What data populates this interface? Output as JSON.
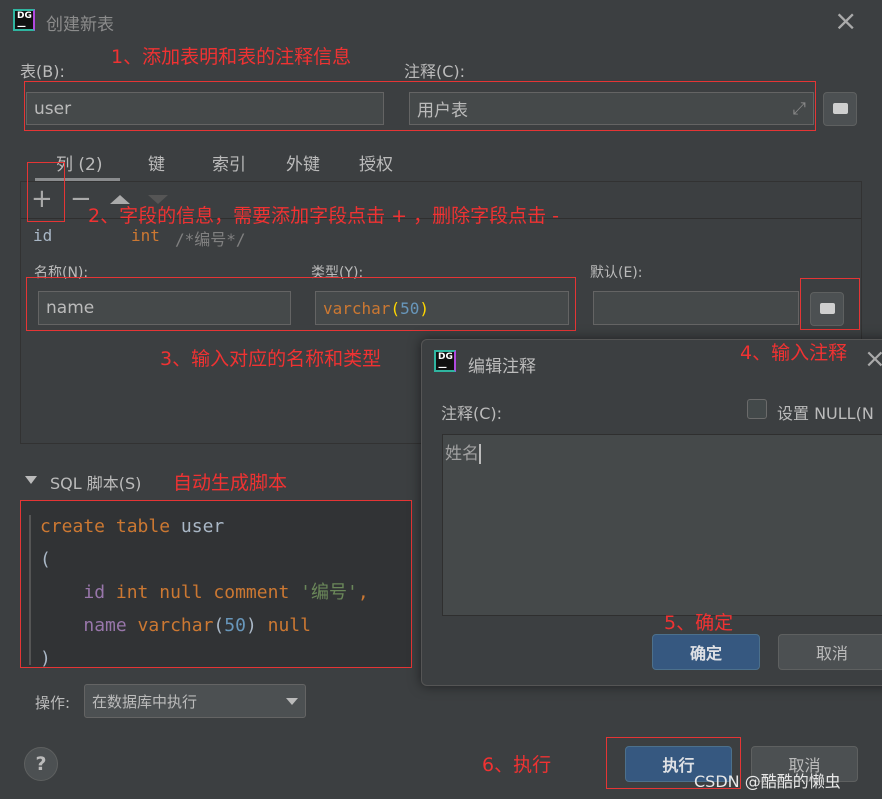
{
  "window": {
    "title": "创建新表",
    "close": "×"
  },
  "table": {
    "label": "表(B):",
    "value": "user",
    "comment_label": "注释(C):",
    "comment_value": "用户表"
  },
  "tabs": [
    {
      "label": "列 (2)",
      "active": true
    },
    {
      "label": "键"
    },
    {
      "label": "索引"
    },
    {
      "label": "外键"
    },
    {
      "label": "授权"
    }
  ],
  "toolbar": {
    "add": "+",
    "remove": "−"
  },
  "columns": [
    {
      "name": "id",
      "type": "int",
      "comment": "/*编号*/"
    }
  ],
  "column_editor": {
    "name_label": "名称(N):",
    "name_value": "name",
    "type_label": "类型(Y):",
    "type_value": "varchar",
    "type_paren_open": "(",
    "type_len": "50",
    "type_paren_close": ")",
    "default_label": "默认(E):",
    "default_value": ""
  },
  "sql": {
    "label": "SQL 脚本(S)",
    "lines": [
      [
        [
          "kw",
          "create table "
        ],
        [
          "",
          "user"
        ]
      ],
      [
        [
          "",
          "("
        ]
      ],
      [
        [
          "",
          "    "
        ],
        [
          "fld",
          "id"
        ],
        [
          "kw",
          " int null comment "
        ],
        [
          "str",
          "'编号'"
        ],
        [
          "kw",
          ","
        ]
      ],
      [
        [
          "",
          "    "
        ],
        [
          "fld",
          "name"
        ],
        [
          "kw",
          " varchar"
        ],
        [
          "",
          "("
        ],
        [
          "num",
          "50"
        ],
        [
          "",
          ")"
        ],
        [
          "kw",
          " null"
        ]
      ],
      [
        [
          "",
          ")"
        ]
      ]
    ]
  },
  "operation": {
    "label": "操作:",
    "value": "在数据库中执行"
  },
  "footer": {
    "help": "?",
    "execute": "执行",
    "cancel": "取消"
  },
  "comment_dialog": {
    "title": "编辑注释",
    "close": "×",
    "label": "注释(C):",
    "null_label": "设置 NULL(N",
    "null_checked": false,
    "value": "姓名",
    "ok": "确定",
    "cancel": "取消"
  },
  "annotations": {
    "a1": "1、添加表明和表的注释信息",
    "a2": "2、字段的信息，需要添加字段点击 + ，删除字段点击 -",
    "a3": "3、输入对应的名称和类型",
    "a4": "4、输入注释",
    "a5": "5、确定",
    "a6": "6、执行",
    "a7": "自动生成脚本"
  },
  "watermark": "CSDN @酷酷的懒虫",
  "colors": {
    "bg": "#3c3f41",
    "accent": "#365880",
    "annotation": "#f03232"
  }
}
